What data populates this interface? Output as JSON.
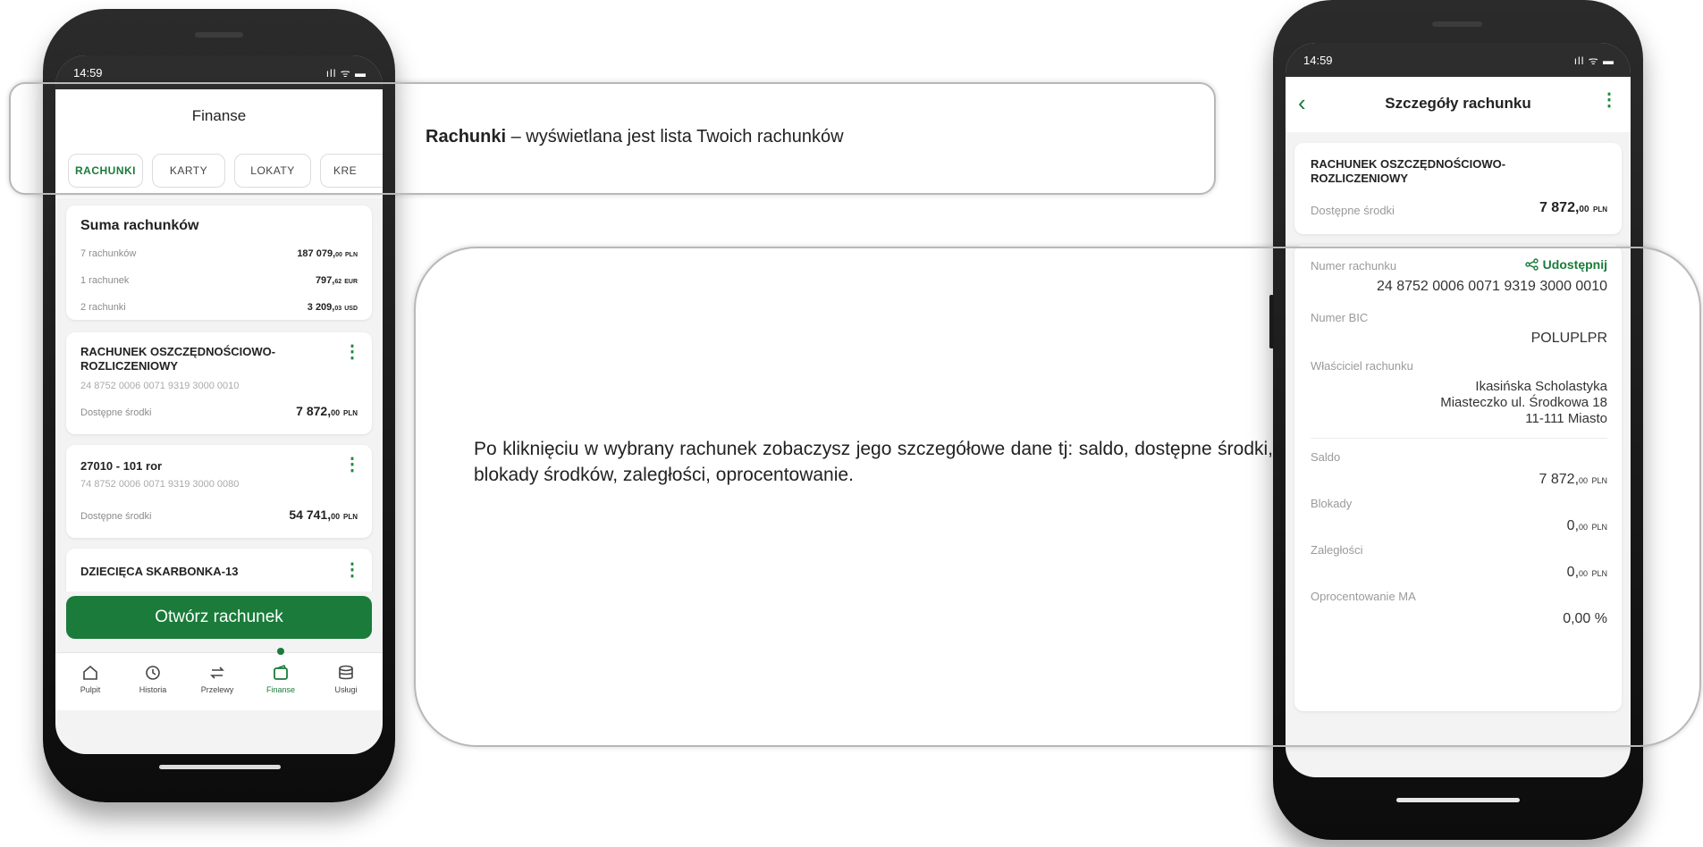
{
  "left_phone": {
    "status": {
      "time": "14:59",
      "icons": "ıll ᯤ ▬"
    },
    "title": "Finanse",
    "tabs": [
      {
        "label": "RACHUNKI",
        "active": true
      },
      {
        "label": "KARTY",
        "active": false
      },
      {
        "label": "LOKATY",
        "active": false
      },
      {
        "label": "KRE",
        "active": false
      }
    ],
    "summary": {
      "title": "Suma rachunków",
      "rows": [
        {
          "label": "7 rachunków",
          "amount": "187 079,",
          "decimals": "00",
          "currency": "PLN"
        },
        {
          "label": "1 rachunek",
          "amount": "797,",
          "decimals": "62",
          "currency": "EUR"
        },
        {
          "label": "2 rachunki",
          "amount": "3 209,",
          "decimals": "03",
          "currency": "USD"
        }
      ]
    },
    "accounts": [
      {
        "name": "RACHUNEK OSZCZĘDNOŚCIOWO-ROZLICZENIOWY",
        "number": "24 8752 0006 0071 9319 3000 0010",
        "balance_label": "Dostępne środki",
        "amount": "7 872,",
        "decimals": "00",
        "currency": "PLN"
      },
      {
        "name": "27010 - 101 ror",
        "number": "74 8752 0006 0071 9319 3000 0080",
        "balance_label": "Dostępne środki",
        "amount": "54 741,",
        "decimals": "00",
        "currency": "PLN"
      },
      {
        "name": "DZIECIĘCA SKARBONKA-13"
      }
    ],
    "open_account_button": "Otwórz rachunek",
    "bottom_nav": [
      {
        "label": "Pulpit",
        "icon": "home-icon",
        "active": false
      },
      {
        "label": "Historia",
        "icon": "history-icon",
        "active": false
      },
      {
        "label": "Przelewy",
        "icon": "transfers-icon",
        "active": false
      },
      {
        "label": "Finanse",
        "icon": "finance-icon",
        "active": true
      },
      {
        "label": "Usługi",
        "icon": "services-icon",
        "active": false
      }
    ]
  },
  "right_phone": {
    "status": {
      "time": "14:59",
      "icons": "ıll ᯤ ▬"
    },
    "title": "Szczegóły rachunku",
    "header_card": {
      "name": "RACHUNEK OSZCZĘDNOŚCIOWO-ROZLICZENIOWY",
      "balance_label": "Dostępne środki",
      "amount": "7 872,",
      "decimals": "00",
      "currency": "PLN"
    },
    "account_number_label": "Numer rachunku",
    "share_label": "Udostępnij",
    "account_number": "24 8752 0006 0071 9319 3000 0010",
    "bic_label": "Numer BIC",
    "bic": "POLUPLPR",
    "owner_label": "Właściciel rachunku",
    "owner_name": "Ikasińska Scholastyka",
    "owner_address1": "Miasteczko ul. Środkowa 18",
    "owner_address2": "11-111 Miasto",
    "saldo_label": "Saldo",
    "saldo_amount": "7 872,",
    "saldo_decimals": "00",
    "saldo_currency": "PLN",
    "blokady_label": "Blokady",
    "blokady_amount": "0,",
    "blokady_decimals": "00",
    "blokady_currency": "PLN",
    "zaleglosci_label": "Zaległości",
    "zaleglosci_amount": "0,",
    "zaleglosci_decimals": "00",
    "zaleglosci_currency": "PLN",
    "oprocentowanie_label": "Oprocentowanie MA",
    "oprocentowanie_value": "0,00 %"
  },
  "callouts": {
    "top_bold": "Rachunki",
    "top_rest": " – wyświetlana jest lista Twoich rachunków",
    "middle": "Po kliknięciu w wybrany rachunek zobaczysz jego szczegółowe dane tj: saldo, dostępne środki, blokady środków, zaległości, oprocentowanie."
  },
  "colors": {
    "brand_green": "#1a7b3a",
    "background": "#f2f3f2"
  }
}
